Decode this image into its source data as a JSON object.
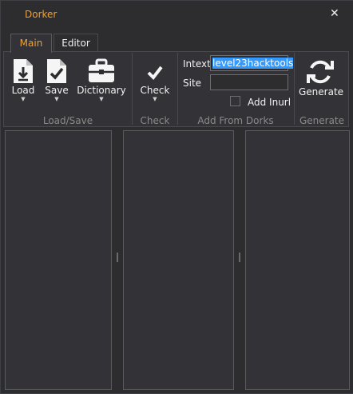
{
  "window": {
    "title": "Dorker",
    "close_label": "✕"
  },
  "tabs": [
    {
      "label": "Main"
    },
    {
      "label": "Editor"
    }
  ],
  "ribbon": {
    "load_save": {
      "group_label": "Load/Save",
      "load": "Load",
      "save": "Save",
      "dictionary": "Dictionary"
    },
    "check": {
      "group_label": "Check",
      "check": "Check"
    },
    "from_dorks": {
      "group_label": "Add From Dorks",
      "intext_label": "Intext",
      "intext_value": "level23hacktools",
      "site_label": "Site",
      "site_value": "",
      "add_inurl_label": "Add Inurl",
      "add_inurl_checked": false
    },
    "generate": {
      "group_label": "Generate",
      "generate": "Generate"
    }
  },
  "dropdown_arrow": "▼",
  "icons": [
    "load-icon",
    "save-icon",
    "dictionary-icon",
    "check-icon",
    "generate-icon",
    "close-icon"
  ],
  "colors": {
    "accent": "#f0a030",
    "selection": "#3399ff",
    "background": "#2d2d30"
  }
}
